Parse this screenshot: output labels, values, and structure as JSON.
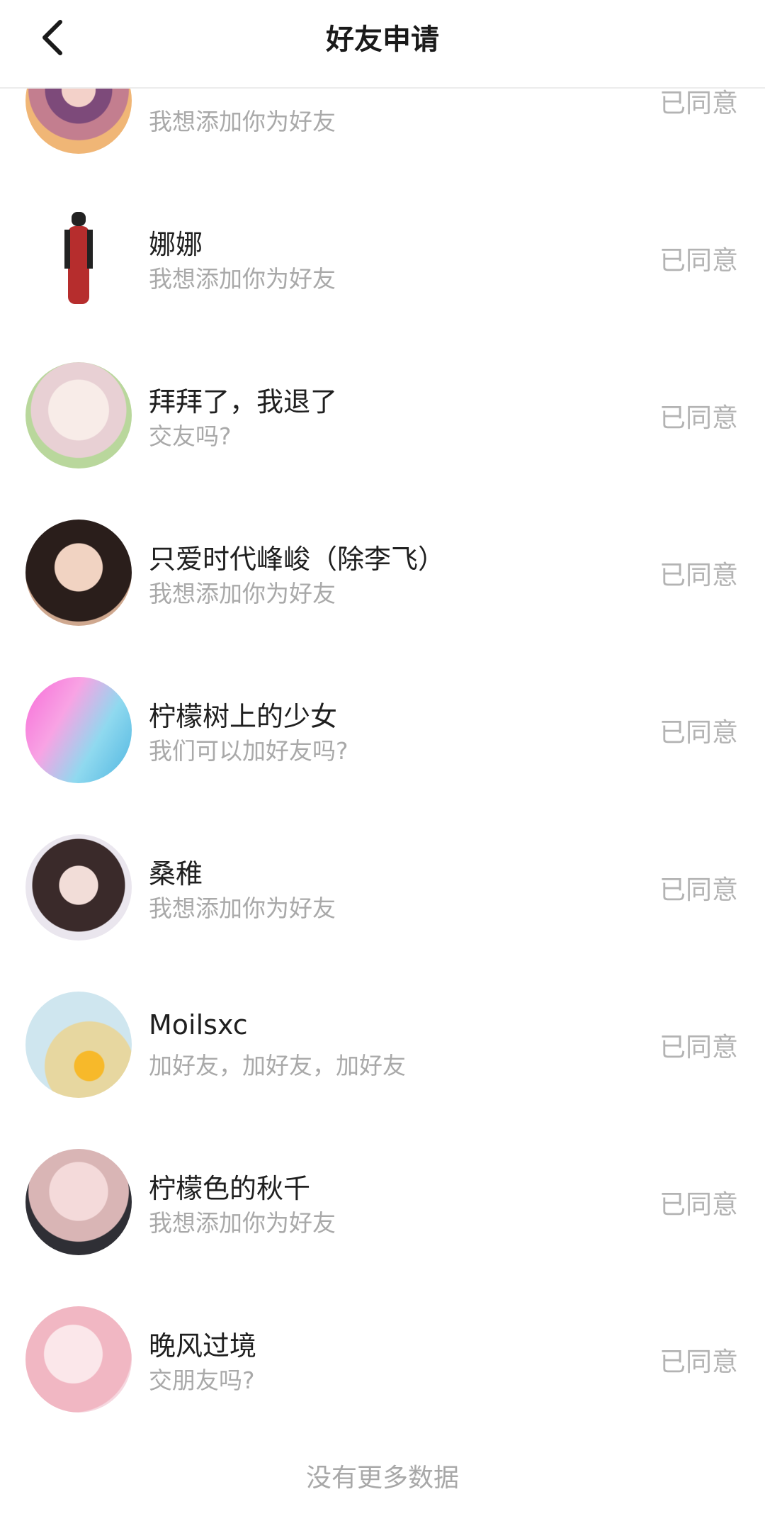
{
  "header": {
    "title": "好友申请",
    "back_icon": "chevron-left-icon"
  },
  "requests": [
    {
      "name": "",
      "message": "我想添加你为好友",
      "status": "已同意"
    },
    {
      "name": "娜娜",
      "message": "我想添加你为好友",
      "status": "已同意"
    },
    {
      "name": "拜拜了，我退了",
      "message": "交友吗?",
      "status": "已同意"
    },
    {
      "name": "只爱时代峰峻（除李飞）",
      "message": "我想添加你为好友",
      "status": "已同意"
    },
    {
      "name": "柠檬树上的少女",
      "message": "我们可以加好友吗?",
      "status": "已同意"
    },
    {
      "name": "桑稚",
      "message": "我想添加你为好友",
      "status": "已同意"
    },
    {
      "name": "Moilsxc",
      "message": "加好友，加好友，加好友",
      "status": "已同意"
    },
    {
      "name": "柠檬色的秋千",
      "message": "我想添加你为好友",
      "status": "已同意"
    },
    {
      "name": "晚风过境",
      "message": "交朋友吗?",
      "status": "已同意"
    }
  ],
  "footer": {
    "text": "没有更多数据"
  }
}
